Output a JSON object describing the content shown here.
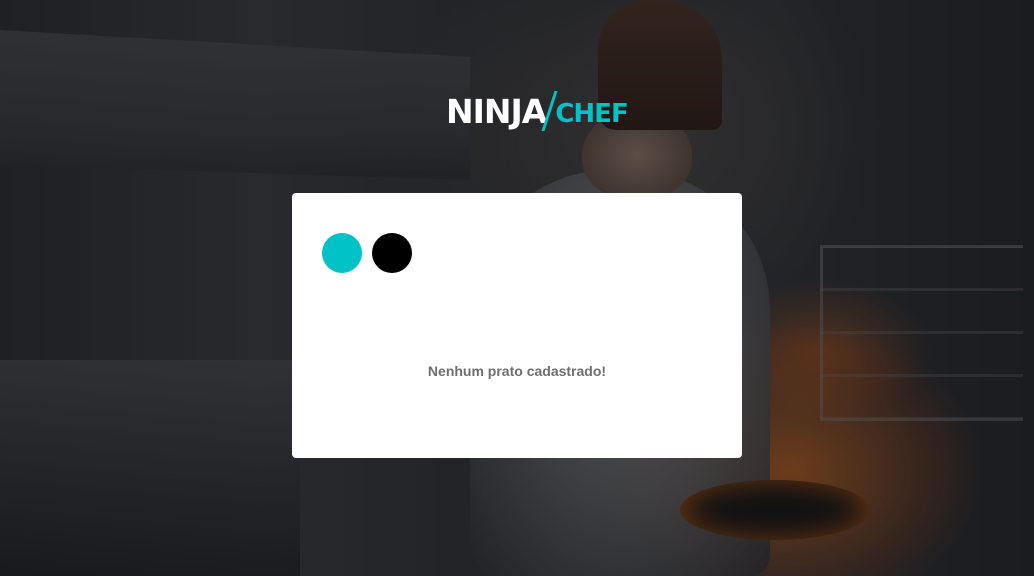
{
  "logo": {
    "part1": "NINJA",
    "part2": "CHEF",
    "part2_color": "#00c2c7"
  },
  "colors": {
    "accent": "#00c2c7",
    "card_background": "#ffffff",
    "message_text": "#6e6e6e"
  },
  "card": {
    "indicators": [
      {
        "color": "#00c2c7",
        "icon": "teal-dot"
      },
      {
        "color": "#000000",
        "icon": "black-dot"
      }
    ],
    "empty_message": "Nenhum prato cadastrado!"
  }
}
